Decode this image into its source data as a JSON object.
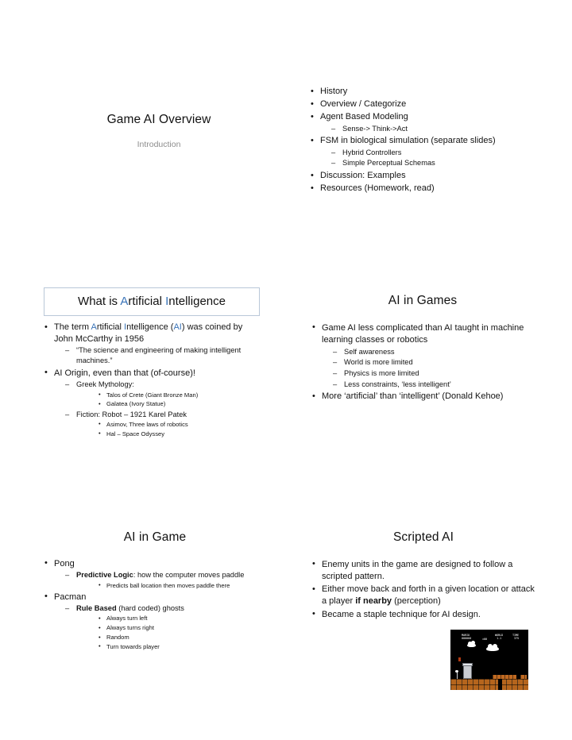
{
  "document": {
    "type": "lecture-slide-handout",
    "background_color": "#ffffff",
    "accent_color": "#3a74b8",
    "subtitle_color": "#8d8d8d",
    "box_border_color": "#b9c7d8"
  },
  "slides": [
    {
      "id": "slide-title",
      "title": "Game AI Overview",
      "subtitle": "Introduction"
    },
    {
      "id": "slide-agenda",
      "bullets": [
        {
          "level": 1,
          "text": "History"
        },
        {
          "level": 1,
          "text": "Overview / Categorize"
        },
        {
          "level": 1,
          "text": "Agent Based Modeling"
        },
        {
          "level": 2,
          "text": "Sense-> Think->Act"
        },
        {
          "level": 1,
          "text": "FSM in biological simulation (separate slides)"
        },
        {
          "level": 2,
          "text": "Hybrid Controllers"
        },
        {
          "level": 2,
          "text": "Simple Perceptual Schemas"
        },
        {
          "level": 1,
          "text": "Discussion: Examples"
        },
        {
          "level": 1,
          "text": "Resources (Homework, read)"
        }
      ]
    },
    {
      "id": "slide-what-is-ai",
      "boxed_title": {
        "parts": [
          {
            "text": "What is ",
            "accent": false
          },
          {
            "text": "A",
            "accent": true
          },
          {
            "text": "rtificial ",
            "accent": false
          },
          {
            "text": "I",
            "accent": true
          },
          {
            "text": "ntelligence",
            "accent": false
          }
        ],
        "plain": "What is Artificial Intelligence"
      },
      "bullets": [
        {
          "level": 1,
          "parts": [
            {
              "text": "The term ",
              "accent": false
            },
            {
              "text": "A",
              "accent": true
            },
            {
              "text": "rtificial ",
              "accent": false
            },
            {
              "text": "I",
              "accent": true
            },
            {
              "text": "ntelligence (",
              "accent": false
            },
            {
              "text": "AI",
              "accent": true
            },
            {
              "text": ") was coined by John McCarthy in 1956",
              "accent": false
            }
          ],
          "plain": "The term Artificial Intelligence (AI) was coined by John McCarthy in 1956"
        },
        {
          "level": 2,
          "text": "“The science and engineering of making intelligent machines.”"
        },
        {
          "level": 1,
          "text": "AI Origin, even than that (of-course)!"
        },
        {
          "level": 2,
          "text": "Greek Mythology:"
        },
        {
          "level": 3,
          "text": "Talos of Crete (Giant Bronze Man)"
        },
        {
          "level": 3,
          "text": "Galatea (Ivory Statue)"
        },
        {
          "level": 2,
          "text": "Fiction:  Robot – 1921 Karel Patek"
        },
        {
          "level": 3,
          "text": "Asimov, Three laws of robotics"
        },
        {
          "level": 3,
          "text": "Hal – Space Odyssey"
        }
      ]
    },
    {
      "id": "slide-ai-in-games",
      "title": "AI in Games",
      "bullets": [
        {
          "level": 1,
          "text": "Game AI less complicated than AI taught in machine learning classes or robotics"
        },
        {
          "level": 2,
          "text": "Self awareness"
        },
        {
          "level": 2,
          "text": "World is more limited"
        },
        {
          "level": 2,
          "text": "Physics is more limited"
        },
        {
          "level": 2,
          "text": "Less constraints, ‘less intelligent’"
        },
        {
          "level": 1,
          "text": "More ‘artificial’ than ‘intelligent’ (Donald Kehoe)"
        }
      ]
    },
    {
      "id": "slide-ai-in-game",
      "title": "AI in Game",
      "bullets": [
        {
          "level": 1,
          "text": "Pong"
        },
        {
          "level": 2,
          "parts": [
            {
              "text": "Predictive Logic",
              "bold": true
            },
            {
              "text": ": how the computer moves paddle",
              "bold": false
            }
          ],
          "plain": "Predictive Logic: how the computer moves paddle"
        },
        {
          "level": 3,
          "text": "Predicts ball location then moves paddle there"
        },
        {
          "level": 1,
          "text": "Pacman"
        },
        {
          "level": 2,
          "parts": [
            {
              "text": "Rule Based",
              "bold": true
            },
            {
              "text": " (hard coded) ghosts",
              "bold": false
            }
          ],
          "plain": "Rule Based (hard coded) ghosts"
        },
        {
          "level": 3,
          "text": "Always turn left"
        },
        {
          "level": 3,
          "text": "Always turns right"
        },
        {
          "level": 3,
          "text": "Random"
        },
        {
          "level": 3,
          "text": "Turn towards player"
        }
      ]
    },
    {
      "id": "slide-scripted-ai",
      "title": "Scripted AI",
      "bullets": [
        {
          "level": 1,
          "text": "Enemy units in the game are designed to follow a scripted pattern."
        },
        {
          "level": 1,
          "parts": [
            {
              "text": "Either move back and forth in a given location or attack a player ",
              "bold": false
            },
            {
              "text": "if nearby",
              "bold": true
            },
            {
              "text": " (perception)",
              "bold": false
            }
          ],
          "plain": "Either move back and forth in a given location or attack a player if nearby (perception)"
        },
        {
          "level": 1,
          "text": "Became a staple technique for AI design."
        }
      ],
      "image": {
        "name": "super-mario-bros-screenshot",
        "hud": {
          "player": "MARIO",
          "score": "000000",
          "coins": "×00",
          "world_label": "WORLD",
          "world_value": "1-1",
          "time_label": "TIME",
          "time_value": "375"
        },
        "background_color": "#000000",
        "ground_color": "#b5651d"
      }
    }
  ]
}
